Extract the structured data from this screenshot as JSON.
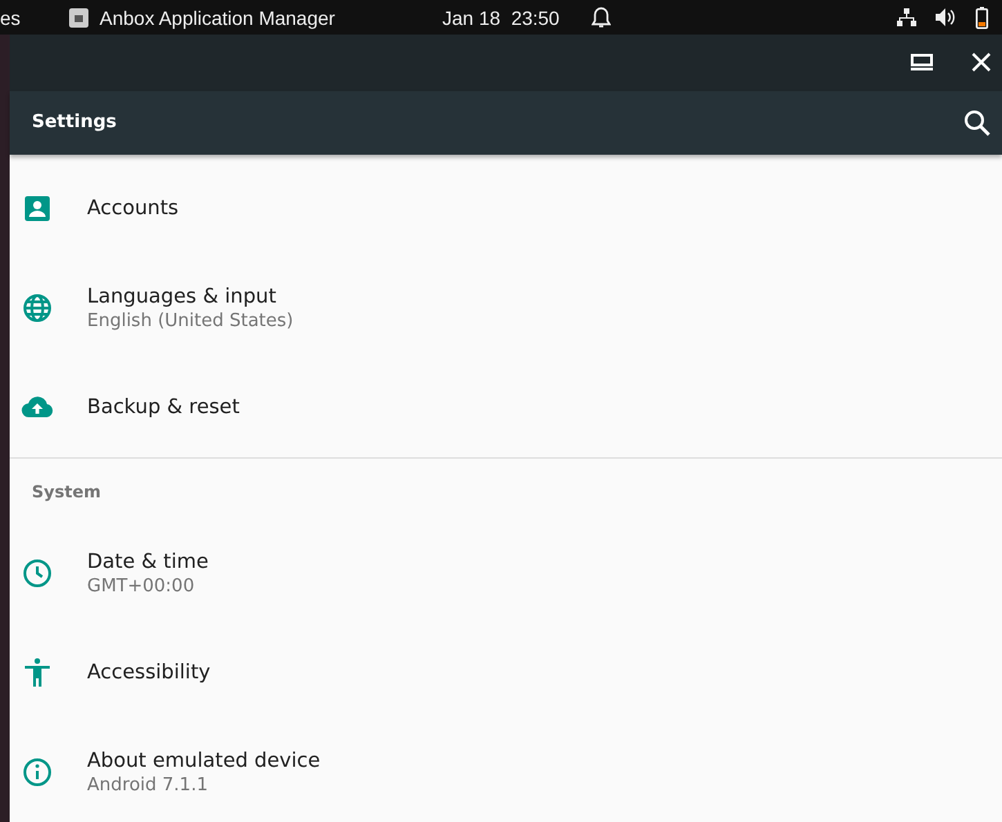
{
  "top_bar": {
    "activities": "es",
    "app_name": "Anbox Application Manager",
    "clock": "Jan 18  23:50"
  },
  "app_bar": {
    "title": "Settings"
  },
  "sections": [
    {
      "items": [
        {
          "title": "Accounts"
        },
        {
          "title": "Languages & input",
          "subtitle": "English (United States)"
        },
        {
          "title": "Backup & reset"
        }
      ]
    },
    {
      "header": "System",
      "items": [
        {
          "title": "Date & time",
          "subtitle": "GMT+00:00"
        },
        {
          "title": "Accessibility"
        },
        {
          "title": "About emulated device",
          "subtitle": "Android 7.1.1"
        }
      ]
    }
  ]
}
